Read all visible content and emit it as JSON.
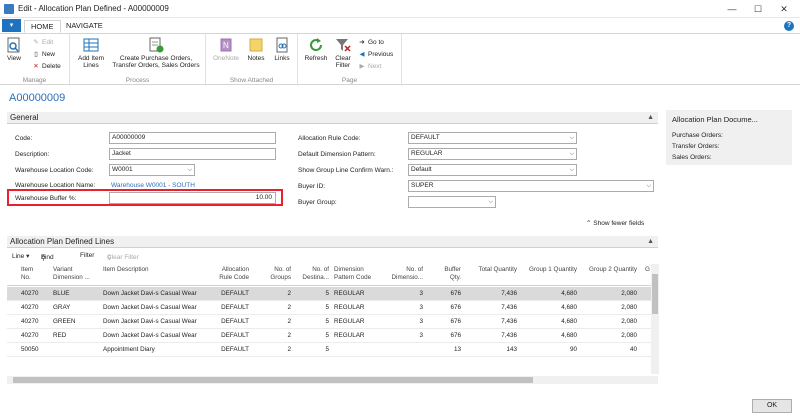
{
  "window": {
    "title": "Edit - Allocation Plan Defined - A00000009",
    "minimize": "—",
    "restore": "☐",
    "close": "✕"
  },
  "ribbon_tabs": {
    "menu": "▾",
    "home": "HOME",
    "navigate": "NAVIGATE",
    "help": "?"
  },
  "ribbon": {
    "manage": {
      "label": "Manage",
      "view": "View",
      "edit": "Edit",
      "new": "New",
      "delete": "Delete"
    },
    "process": {
      "label": "Process",
      "add_item_lines": [
        "Add Item",
        "Lines"
      ],
      "create_orders": [
        "Create Purchase Orders,",
        "Transfer Orders, Sales Orders"
      ]
    },
    "show_attached": {
      "label": "Show Attached",
      "onenote": "OneNote",
      "notes": "Notes",
      "links": "Links"
    },
    "page": {
      "label": "Page",
      "refresh": "Refresh",
      "clear_filter": [
        "Clear",
        "Filter"
      ],
      "goto": "Go to",
      "previous": "Previous",
      "next": "Next"
    }
  },
  "record_no": "A00000009",
  "general": {
    "header": "General",
    "code_label": "Code:",
    "code": "A00000009",
    "description_label": "Description:",
    "description": "Jacket",
    "wh_location_code_label": "Warehouse Location Code:",
    "wh_location_code": "W0001",
    "wh_location_name_label": "Warehouse Location Name:",
    "wh_location_name": "Warehouse W0001 - SOUTH",
    "wh_buffer_label": "Warehouse Buffer %:",
    "wh_buffer": "10.00",
    "alloc_rule_code_label": "Allocation Rule Code:",
    "alloc_rule_code": "DEFAULT",
    "default_dim_pattern_label": "Default Dimension Pattern:",
    "default_dim_pattern": "REGULAR",
    "show_group_line_label": "Show Group Line Confirm Warn.:",
    "show_group_line": "Default",
    "buyer_id_label": "Buyer ID:",
    "buyer_id": "SUPER",
    "buyer_group_label": "Buyer Group:",
    "buyer_group": "",
    "show_fewer": "Show fewer fields"
  },
  "factbox": {
    "title": "Allocation Plan Docume...",
    "purchase_orders": "Purchase Orders:",
    "transfer_orders": "Transfer Orders:",
    "sales_orders": "Sales Orders:"
  },
  "lines": {
    "header": "Allocation Plan Defined Lines",
    "toolbar": {
      "line": "Line ▾",
      "find": "Find",
      "filter": "Filter",
      "clear_filter": "Clear Filter"
    },
    "columns": [
      [
        "Item",
        "No."
      ],
      [
        "Variant",
        "Dimension ..."
      ],
      [
        "Item Description"
      ],
      [
        "Allocation",
        "Rule Code"
      ],
      [
        "No. of",
        "Groups"
      ],
      [
        "No. of",
        "Destina..."
      ],
      [
        "Dimension",
        "Pattern Code"
      ],
      [
        "No. of",
        "Dimensio..."
      ],
      [
        "Buffer",
        "Qty."
      ],
      [
        "Total Quantity"
      ],
      [
        "Group 1 Quantity"
      ],
      [
        "Group 2 Quantity"
      ],
      [
        "G"
      ]
    ],
    "rows": [
      [
        "40270",
        "BLUE",
        "Down Jacket Davi-s Casual Wear",
        "DEFAULT",
        "2",
        "5",
        "REGULAR",
        "3",
        "676",
        "7,436",
        "4,680",
        "2,080"
      ],
      [
        "40270",
        "GRAY",
        "Down Jacket Davi-s Casual Wear",
        "DEFAULT",
        "2",
        "5",
        "REGULAR",
        "3",
        "676",
        "7,436",
        "4,680",
        "2,080"
      ],
      [
        "40270",
        "GREEN",
        "Down Jacket Davi-s Casual Wear",
        "DEFAULT",
        "2",
        "5",
        "REGULAR",
        "3",
        "676",
        "7,436",
        "4,680",
        "2,080"
      ],
      [
        "40270",
        "RED",
        "Down Jacket Davi-s Casual Wear",
        "DEFAULT",
        "2",
        "5",
        "REGULAR",
        "3",
        "676",
        "7,436",
        "4,680",
        "2,080"
      ],
      [
        "50050",
        "",
        "Appointment Diary",
        "DEFAULT",
        "2",
        "5",
        "",
        "",
        "13",
        "143",
        "90",
        "40"
      ]
    ]
  },
  "ok": "OK"
}
